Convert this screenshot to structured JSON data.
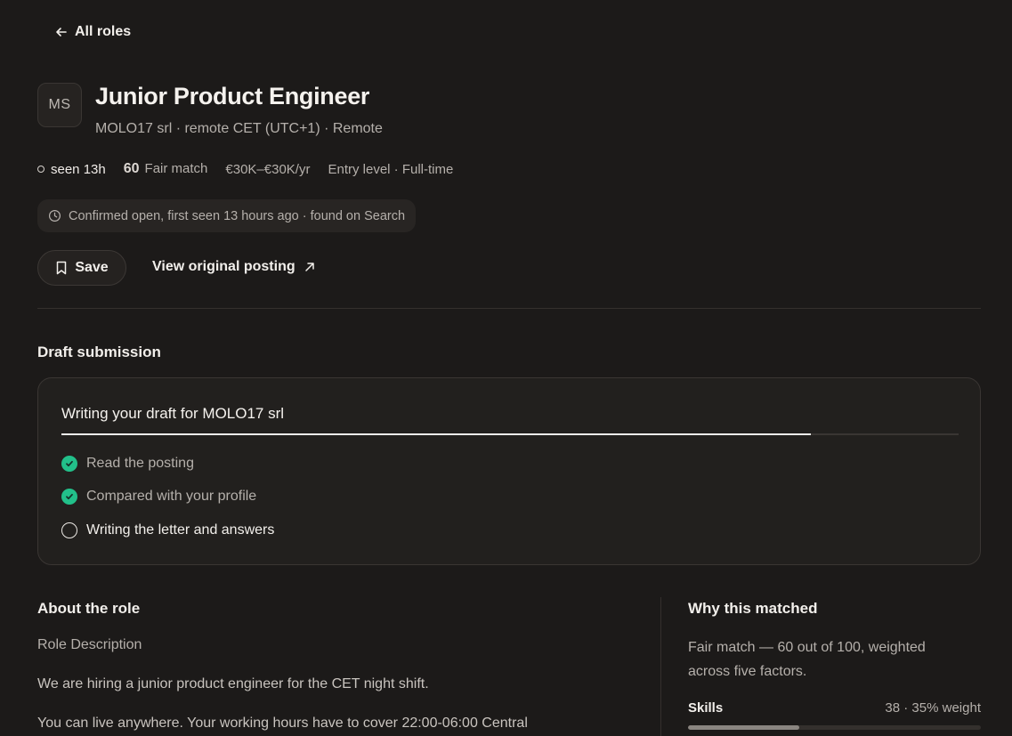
{
  "nav": {
    "back_label": "All roles"
  },
  "job": {
    "logo_initials": "MS",
    "title": "Junior Product Engineer",
    "subtitle": "MOLO17 srl · remote CET (UTC+1) · Remote"
  },
  "meta": {
    "seen": "seen 13h",
    "score": "60",
    "match_label": "Fair match",
    "salary": "€30K–€30K/yr",
    "level": "Entry level · Full-time"
  },
  "status": {
    "text": "Confirmed open, first seen 13 hours ago · found on Search"
  },
  "actions": {
    "save_label": "Save",
    "view_label": "View original posting"
  },
  "draft": {
    "section_title": "Draft submission",
    "heading": "Writing your draft for MOLO17 srl",
    "progress": 0.835,
    "steps": [
      {
        "label": "Read the posting",
        "state": "done"
      },
      {
        "label": "Compared with your profile",
        "state": "done"
      },
      {
        "label": "Writing the letter and answers",
        "state": "active"
      }
    ]
  },
  "about": {
    "section_title": "About the role",
    "role_desc_label": "Role Description",
    "paragraphs": [
      "We are hiring a junior product engineer for the CET night shift.",
      "You can live anywhere. Your working hours have to cover 22:00-06:00 Central"
    ]
  },
  "why": {
    "section_title": "Why this matched",
    "text": "Fair match — 60 out of 100, weighted across five factors.",
    "factors": [
      {
        "name": "Skills",
        "value": "38 · 35% weight",
        "score": 0.38
      }
    ]
  },
  "colors": {
    "background": "#1c1a19",
    "accent_check": "#22c08a",
    "text_primary": "#f2efeb",
    "text_muted": "#b5b0ab"
  }
}
